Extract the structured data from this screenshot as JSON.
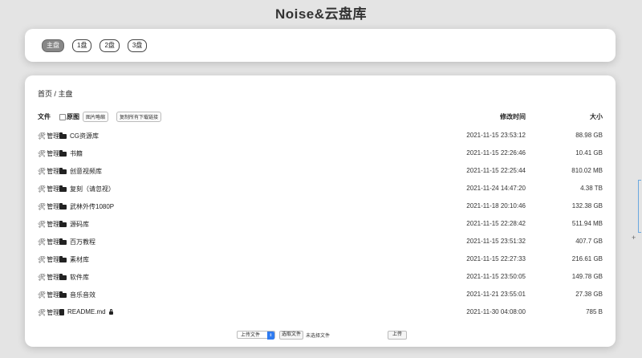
{
  "title": "Noise&云盘库",
  "disks": [
    {
      "label": "主盘",
      "active": true
    },
    {
      "label": "1盘",
      "active": false
    },
    {
      "label": "2盘",
      "active": false
    },
    {
      "label": "3盘",
      "active": false
    }
  ],
  "breadcrumb": "首页 / 主盘",
  "header": {
    "file": "文件",
    "original": "原图",
    "thumb_btn": "图片略缩",
    "copy_btn": "复制所有下载链接",
    "time": "修改时间",
    "size": "大小"
  },
  "manage_label": "管理",
  "rows": [
    {
      "name": "CG资源库",
      "time": "2021-11-15 23:53:12",
      "size": "88.98 GB",
      "type": "folder"
    },
    {
      "name": "书籍",
      "time": "2021-11-15 22:26:46",
      "size": "10.41 GB",
      "type": "folder"
    },
    {
      "name": "创意视频库",
      "time": "2021-11-15 22:25:44",
      "size": "810.02 MB",
      "type": "folder"
    },
    {
      "name": "复刻（请忽视）",
      "time": "2021-11-24 14:47:20",
      "size": "4.38 TB",
      "type": "folder"
    },
    {
      "name": "武林外传1080P",
      "time": "2021-11-18 20:10:46",
      "size": "132.38 GB",
      "type": "folder"
    },
    {
      "name": "源码库",
      "time": "2021-11-15 22:28:42",
      "size": "511.94 MB",
      "type": "folder"
    },
    {
      "name": "百万教程",
      "time": "2021-11-15 23:51:32",
      "size": "407.7 GB",
      "type": "folder"
    },
    {
      "name": "素材库",
      "time": "2021-11-15 22:27:33",
      "size": "216.61 GB",
      "type": "folder"
    },
    {
      "name": "软件库",
      "time": "2021-11-15 23:50:05",
      "size": "149.78 GB",
      "type": "folder"
    },
    {
      "name": "音乐音效",
      "time": "2021-11-21 23:55:01",
      "size": "27.38 GB",
      "type": "folder"
    },
    {
      "name": "README.md",
      "time": "2021-11-30 04:08:00",
      "size": "785 B",
      "type": "file"
    }
  ],
  "upload": {
    "select_label": "上传文件",
    "choose_label": "选取文件",
    "no_file": "未选择文件",
    "submit_label": "上传"
  },
  "colors": {
    "accent": "#2f7bf0",
    "active_disk": "#888888"
  }
}
